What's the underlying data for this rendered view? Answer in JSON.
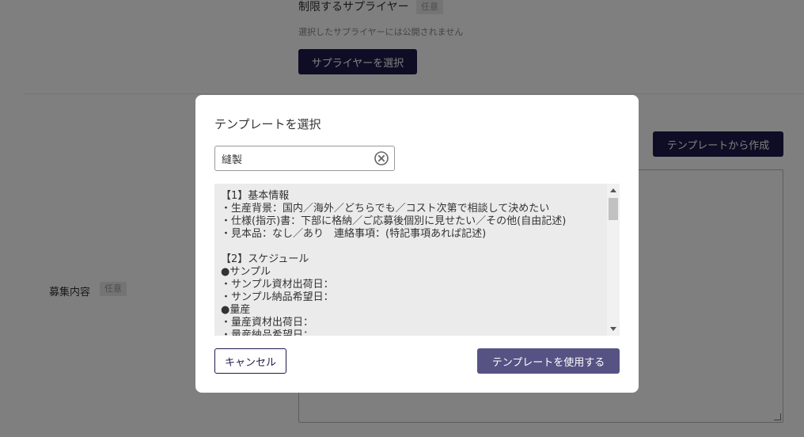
{
  "background": {
    "supplier": {
      "label": "制限するサプライヤー",
      "badge": "任意",
      "help_text": "選択したサプライヤーには公開されません",
      "select_button": "サプライヤーを選択"
    },
    "recruitment": {
      "label": "募集内容",
      "badge": "任意",
      "template_button": "テンプレートから作成"
    }
  },
  "modal": {
    "title": "テンプレートを選択",
    "search": {
      "value": "縫製",
      "placeholder": ""
    },
    "template_text": "【1】基本情報\n・生産背景：国内／海外／どちらでも／コスト次第で相談して決めたい\n・仕様(指示)書：下部に格納／ご応募後個別に見せたい／その他(自由記述)\n・見本品：なし／あり　連絡事項：(特記事項あれば記述)\n\n【2】スケジュール\n●サンプル\n・サンプル資材出荷日：\n・サンプル納品希望日：\n●量産\n・量産資材出荷日：\n・量産納品希望日：",
    "cancel_label": "キャンセル",
    "use_label": "テンプレートを使用する"
  },
  "colors": {
    "primary_dark": "#1e1b4b",
    "primary_muted": "#565384",
    "overlay": "rgba(0,0,0,0.5)"
  },
  "icons": {
    "clear": "circle-x-icon",
    "scroll_up": "triangle-up-icon",
    "scroll_down": "triangle-down-icon",
    "resize": "resize-grip-icon"
  }
}
